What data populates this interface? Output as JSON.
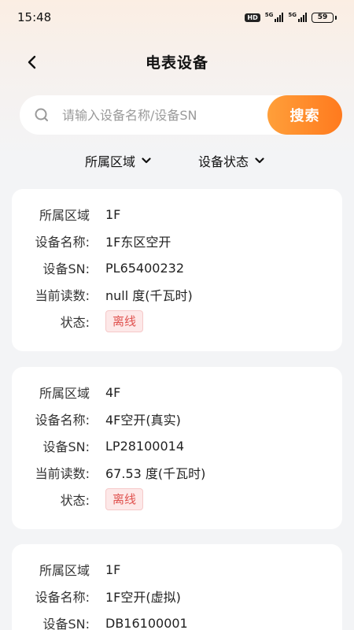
{
  "status_bar": {
    "time": "15:48",
    "hd": "HD",
    "signal1": "5G",
    "signal2": "5G",
    "battery": "59"
  },
  "nav": {
    "title": "电表设备",
    "back_icon": "chevron-left-icon"
  },
  "search": {
    "placeholder": "请输入设备名称/设备SN",
    "value": "",
    "button_label": "搜索",
    "icon": "search-icon"
  },
  "filters": [
    {
      "label": "所属区域",
      "icon": "chevron-down-icon"
    },
    {
      "label": "设备状态",
      "icon": "chevron-down-icon"
    }
  ],
  "labels": {
    "region": "所属区域",
    "name": "设备名称:",
    "sn": "设备SN:",
    "reading": "当前读数:",
    "status": "状态:"
  },
  "devices": [
    {
      "region": "1F",
      "name": "1F东区空开",
      "sn": "PL65400232",
      "reading": "null 度(千瓦时)",
      "status": "离线"
    },
    {
      "region": "4F",
      "name": "4F空开(真实)",
      "sn": "LP28100014",
      "reading": "67.53 度(千瓦时)",
      "status": "离线"
    },
    {
      "region": "1F",
      "name": "1F空开(虚拟)",
      "sn": "DB16100001",
      "reading": "",
      "status": ""
    }
  ],
  "colors": {
    "accent": "#ff8a2a",
    "offline_text": "#e0524f",
    "offline_bg": "#fde8e8"
  }
}
